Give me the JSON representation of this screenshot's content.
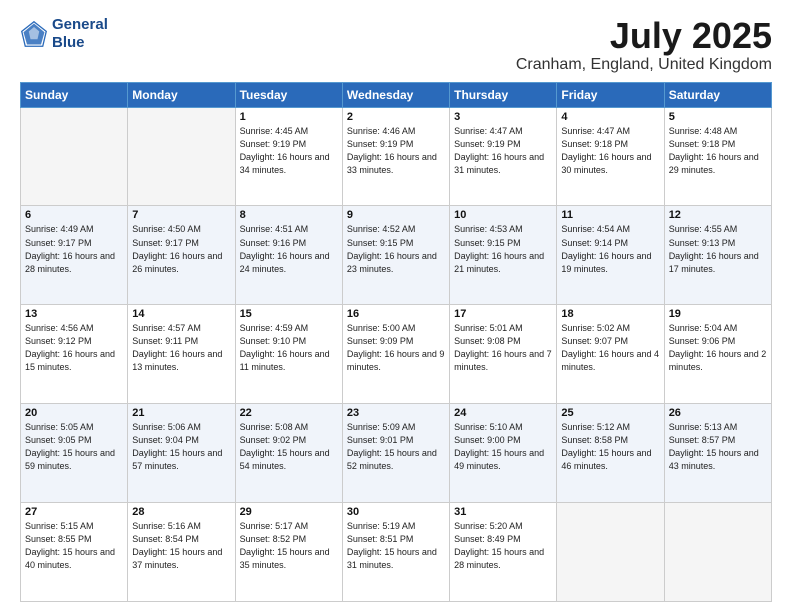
{
  "header": {
    "logo_line1": "General",
    "logo_line2": "Blue",
    "title": "July 2025",
    "location": "Cranham, England, United Kingdom"
  },
  "days_of_week": [
    "Sunday",
    "Monday",
    "Tuesday",
    "Wednesday",
    "Thursday",
    "Friday",
    "Saturday"
  ],
  "weeks": [
    {
      "cells": [
        {
          "day": null
        },
        {
          "day": null
        },
        {
          "day": "1",
          "sunrise": "Sunrise: 4:45 AM",
          "sunset": "Sunset: 9:19 PM",
          "daylight": "Daylight: 16 hours and 34 minutes."
        },
        {
          "day": "2",
          "sunrise": "Sunrise: 4:46 AM",
          "sunset": "Sunset: 9:19 PM",
          "daylight": "Daylight: 16 hours and 33 minutes."
        },
        {
          "day": "3",
          "sunrise": "Sunrise: 4:47 AM",
          "sunset": "Sunset: 9:19 PM",
          "daylight": "Daylight: 16 hours and 31 minutes."
        },
        {
          "day": "4",
          "sunrise": "Sunrise: 4:47 AM",
          "sunset": "Sunset: 9:18 PM",
          "daylight": "Daylight: 16 hours and 30 minutes."
        },
        {
          "day": "5",
          "sunrise": "Sunrise: 4:48 AM",
          "sunset": "Sunset: 9:18 PM",
          "daylight": "Daylight: 16 hours and 29 minutes."
        }
      ]
    },
    {
      "cells": [
        {
          "day": "6",
          "sunrise": "Sunrise: 4:49 AM",
          "sunset": "Sunset: 9:17 PM",
          "daylight": "Daylight: 16 hours and 28 minutes."
        },
        {
          "day": "7",
          "sunrise": "Sunrise: 4:50 AM",
          "sunset": "Sunset: 9:17 PM",
          "daylight": "Daylight: 16 hours and 26 minutes."
        },
        {
          "day": "8",
          "sunrise": "Sunrise: 4:51 AM",
          "sunset": "Sunset: 9:16 PM",
          "daylight": "Daylight: 16 hours and 24 minutes."
        },
        {
          "day": "9",
          "sunrise": "Sunrise: 4:52 AM",
          "sunset": "Sunset: 9:15 PM",
          "daylight": "Daylight: 16 hours and 23 minutes."
        },
        {
          "day": "10",
          "sunrise": "Sunrise: 4:53 AM",
          "sunset": "Sunset: 9:15 PM",
          "daylight": "Daylight: 16 hours and 21 minutes."
        },
        {
          "day": "11",
          "sunrise": "Sunrise: 4:54 AM",
          "sunset": "Sunset: 9:14 PM",
          "daylight": "Daylight: 16 hours and 19 minutes."
        },
        {
          "day": "12",
          "sunrise": "Sunrise: 4:55 AM",
          "sunset": "Sunset: 9:13 PM",
          "daylight": "Daylight: 16 hours and 17 minutes."
        }
      ]
    },
    {
      "cells": [
        {
          "day": "13",
          "sunrise": "Sunrise: 4:56 AM",
          "sunset": "Sunset: 9:12 PM",
          "daylight": "Daylight: 16 hours and 15 minutes."
        },
        {
          "day": "14",
          "sunrise": "Sunrise: 4:57 AM",
          "sunset": "Sunset: 9:11 PM",
          "daylight": "Daylight: 16 hours and 13 minutes."
        },
        {
          "day": "15",
          "sunrise": "Sunrise: 4:59 AM",
          "sunset": "Sunset: 9:10 PM",
          "daylight": "Daylight: 16 hours and 11 minutes."
        },
        {
          "day": "16",
          "sunrise": "Sunrise: 5:00 AM",
          "sunset": "Sunset: 9:09 PM",
          "daylight": "Daylight: 16 hours and 9 minutes."
        },
        {
          "day": "17",
          "sunrise": "Sunrise: 5:01 AM",
          "sunset": "Sunset: 9:08 PM",
          "daylight": "Daylight: 16 hours and 7 minutes."
        },
        {
          "day": "18",
          "sunrise": "Sunrise: 5:02 AM",
          "sunset": "Sunset: 9:07 PM",
          "daylight": "Daylight: 16 hours and 4 minutes."
        },
        {
          "day": "19",
          "sunrise": "Sunrise: 5:04 AM",
          "sunset": "Sunset: 9:06 PM",
          "daylight": "Daylight: 16 hours and 2 minutes."
        }
      ]
    },
    {
      "cells": [
        {
          "day": "20",
          "sunrise": "Sunrise: 5:05 AM",
          "sunset": "Sunset: 9:05 PM",
          "daylight": "Daylight: 15 hours and 59 minutes."
        },
        {
          "day": "21",
          "sunrise": "Sunrise: 5:06 AM",
          "sunset": "Sunset: 9:04 PM",
          "daylight": "Daylight: 15 hours and 57 minutes."
        },
        {
          "day": "22",
          "sunrise": "Sunrise: 5:08 AM",
          "sunset": "Sunset: 9:02 PM",
          "daylight": "Daylight: 15 hours and 54 minutes."
        },
        {
          "day": "23",
          "sunrise": "Sunrise: 5:09 AM",
          "sunset": "Sunset: 9:01 PM",
          "daylight": "Daylight: 15 hours and 52 minutes."
        },
        {
          "day": "24",
          "sunrise": "Sunrise: 5:10 AM",
          "sunset": "Sunset: 9:00 PM",
          "daylight": "Daylight: 15 hours and 49 minutes."
        },
        {
          "day": "25",
          "sunrise": "Sunrise: 5:12 AM",
          "sunset": "Sunset: 8:58 PM",
          "daylight": "Daylight: 15 hours and 46 minutes."
        },
        {
          "day": "26",
          "sunrise": "Sunrise: 5:13 AM",
          "sunset": "Sunset: 8:57 PM",
          "daylight": "Daylight: 15 hours and 43 minutes."
        }
      ]
    },
    {
      "cells": [
        {
          "day": "27",
          "sunrise": "Sunrise: 5:15 AM",
          "sunset": "Sunset: 8:55 PM",
          "daylight": "Daylight: 15 hours and 40 minutes."
        },
        {
          "day": "28",
          "sunrise": "Sunrise: 5:16 AM",
          "sunset": "Sunset: 8:54 PM",
          "daylight": "Daylight: 15 hours and 37 minutes."
        },
        {
          "day": "29",
          "sunrise": "Sunrise: 5:17 AM",
          "sunset": "Sunset: 8:52 PM",
          "daylight": "Daylight: 15 hours and 35 minutes."
        },
        {
          "day": "30",
          "sunrise": "Sunrise: 5:19 AM",
          "sunset": "Sunset: 8:51 PM",
          "daylight": "Daylight: 15 hours and 31 minutes."
        },
        {
          "day": "31",
          "sunrise": "Sunrise: 5:20 AM",
          "sunset": "Sunset: 8:49 PM",
          "daylight": "Daylight: 15 hours and 28 minutes."
        },
        {
          "day": null
        },
        {
          "day": null
        }
      ]
    }
  ]
}
